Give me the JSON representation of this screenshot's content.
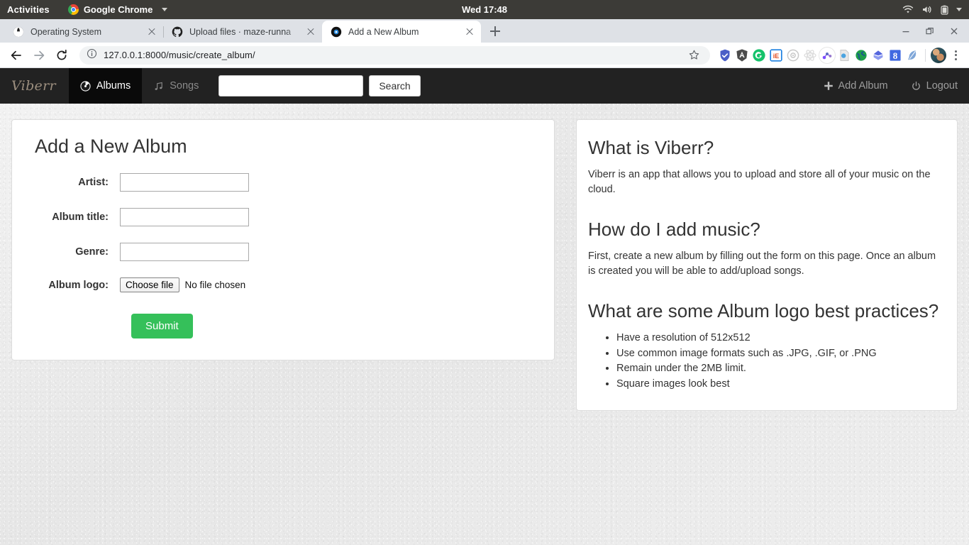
{
  "system_bar": {
    "activities": "Activities",
    "app_name": "Google Chrome",
    "clock": "Wed 17:48",
    "icons": [
      "wifi-icon",
      "volume-icon",
      "battery-icon",
      "system-menu-caret-icon"
    ]
  },
  "browser": {
    "tabs": [
      {
        "title": "Operating System",
        "favicon": "globe-icon",
        "active": false
      },
      {
        "title": "Upload files · maze-runna",
        "favicon": "github-icon",
        "active": false
      },
      {
        "title": "Add a New Album",
        "favicon": "disc-icon",
        "active": true
      }
    ],
    "new_tab_label": "+",
    "window_controls": [
      "minimize",
      "maximize",
      "close"
    ],
    "toolbar": {
      "back": "back-icon",
      "forward": "forward-icon",
      "reload": "reload-icon",
      "site_info": "info-icon",
      "url": "127.0.0.1:8000/music/create_album/",
      "bookmark": "star-icon",
      "extensions": [
        {
          "name": "shield-extension-icon",
          "color": "#4a5ec7",
          "glyph": "✓"
        },
        {
          "name": "angular-extension-icon",
          "color": "#4b4b4b",
          "glyph": "A"
        },
        {
          "name": "grammarly-extension-icon",
          "color": "#15c26b",
          "glyph": "G"
        },
        {
          "name": "ie-tab-extension-icon",
          "color": "#ffffff",
          "glyph": "iE"
        },
        {
          "name": "target-extension-icon",
          "color": "#d9d9d9",
          "glyph": "◎"
        },
        {
          "name": "react-extension-icon",
          "color": "#e4e4e4",
          "glyph": "⚛"
        },
        {
          "name": "molecule-extension-icon",
          "color": "#ffffff",
          "glyph": "⚬"
        },
        {
          "name": "document-extension-icon",
          "color": "#dcdcdc",
          "glyph": "▤"
        },
        {
          "name": "globe-extension-icon",
          "color": "#1e9e4a",
          "glyph": "●"
        },
        {
          "name": "diamond-extension-icon",
          "color": "#5566dd",
          "glyph": "◆"
        },
        {
          "name": "google-scholar-extension-icon",
          "color": "#4169e1",
          "glyph": "8"
        },
        {
          "name": "feather-extension-icon",
          "color": "#7ea6d8",
          "glyph": "✐"
        }
      ],
      "profile": "avatar",
      "menu": "kebab-menu-icon"
    }
  },
  "app": {
    "brand": "Viberr",
    "nav": [
      {
        "label": "Albums",
        "icon": "disc-icon",
        "active": true
      },
      {
        "label": "Songs",
        "icon": "music-note-icon",
        "active": false
      }
    ],
    "search": {
      "value": "",
      "placeholder": "",
      "button_label": "Search"
    },
    "actions": [
      {
        "label": "Add Album",
        "icon": "plus-icon"
      },
      {
        "label": "Logout",
        "icon": "power-icon"
      }
    ]
  },
  "form": {
    "title": "Add a New Album",
    "fields": [
      {
        "label": "Artist:",
        "value": "",
        "placeholder": "",
        "type": "text"
      },
      {
        "label": "Album title:",
        "value": "",
        "placeholder": "",
        "type": "text"
      },
      {
        "label": "Genre:",
        "value": "",
        "placeholder": "",
        "type": "text"
      }
    ],
    "file_field": {
      "label": "Album logo:",
      "button_label": "Choose file",
      "status": "No file chosen"
    },
    "submit_label": "Submit"
  },
  "info": {
    "sections": [
      {
        "heading": "What is Viberr?",
        "paragraph": "Viberr is an app that allows you to upload and store all of your music on the cloud."
      },
      {
        "heading": "How do I add music?",
        "paragraph": "First, create a new album by filling out the form on this page. Once an album is created you will be able to add/upload songs."
      }
    ],
    "practices_heading": "What are some Album logo best practices?",
    "practices": [
      "Have a resolution of 512x512",
      "Use common image formats such as .JPG, .GIF, or .PNG",
      "Remain under the 2MB limit.",
      "Square images look best"
    ]
  },
  "colors": {
    "navbar_bg": "#222222",
    "navbar_active_bg": "#0a0a0a",
    "brand": "#9b8e7e",
    "submit_green": "#35c05a",
    "page_bg": "#ececec",
    "gnome_bar": "#3c3b37"
  }
}
